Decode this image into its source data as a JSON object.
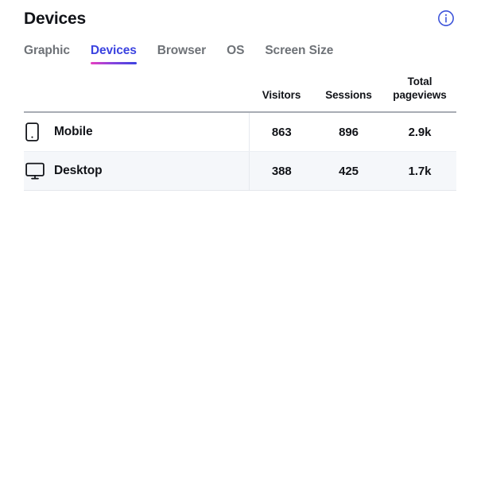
{
  "panel": {
    "title": "Devices",
    "info_icon": "info-circle-icon"
  },
  "tabs": [
    {
      "id": "graphic",
      "label": "Graphic",
      "active": false
    },
    {
      "id": "devices",
      "label": "Devices",
      "active": true
    },
    {
      "id": "browser",
      "label": "Browser",
      "active": false
    },
    {
      "id": "os",
      "label": "OS",
      "active": false
    },
    {
      "id": "screen-size",
      "label": "Screen Size",
      "active": false
    }
  ],
  "table": {
    "columns": [
      {
        "key": "device",
        "label": "",
        "align": "left"
      },
      {
        "key": "visitors",
        "label": "Visitors",
        "align": "center"
      },
      {
        "key": "sessions",
        "label": "Sessions",
        "align": "center"
      },
      {
        "key": "pageviews",
        "label": "Total\npageviews",
        "label_line1": "Total",
        "label_line2": "pageviews",
        "align": "center"
      }
    ],
    "rows": [
      {
        "icon": "mobile-phone-icon",
        "device": "Mobile",
        "visitors": "863",
        "sessions": "896",
        "pageviews": "2.9k"
      },
      {
        "icon": "desktop-monitor-icon",
        "device": "Desktop",
        "visitors": "388",
        "sessions": "425",
        "pageviews": "1.7k"
      }
    ]
  },
  "colors": {
    "accent_active_tab": "#3b43e0",
    "underline_gradient_start": "#e83fc0",
    "underline_gradient_end": "#3b43e0",
    "inactive_tab": "#6e7277",
    "text_primary": "#111318",
    "row_alt_background": "#f5f7fa",
    "header_rule": "#a8acb4",
    "info_icon": "#3b52d9"
  }
}
